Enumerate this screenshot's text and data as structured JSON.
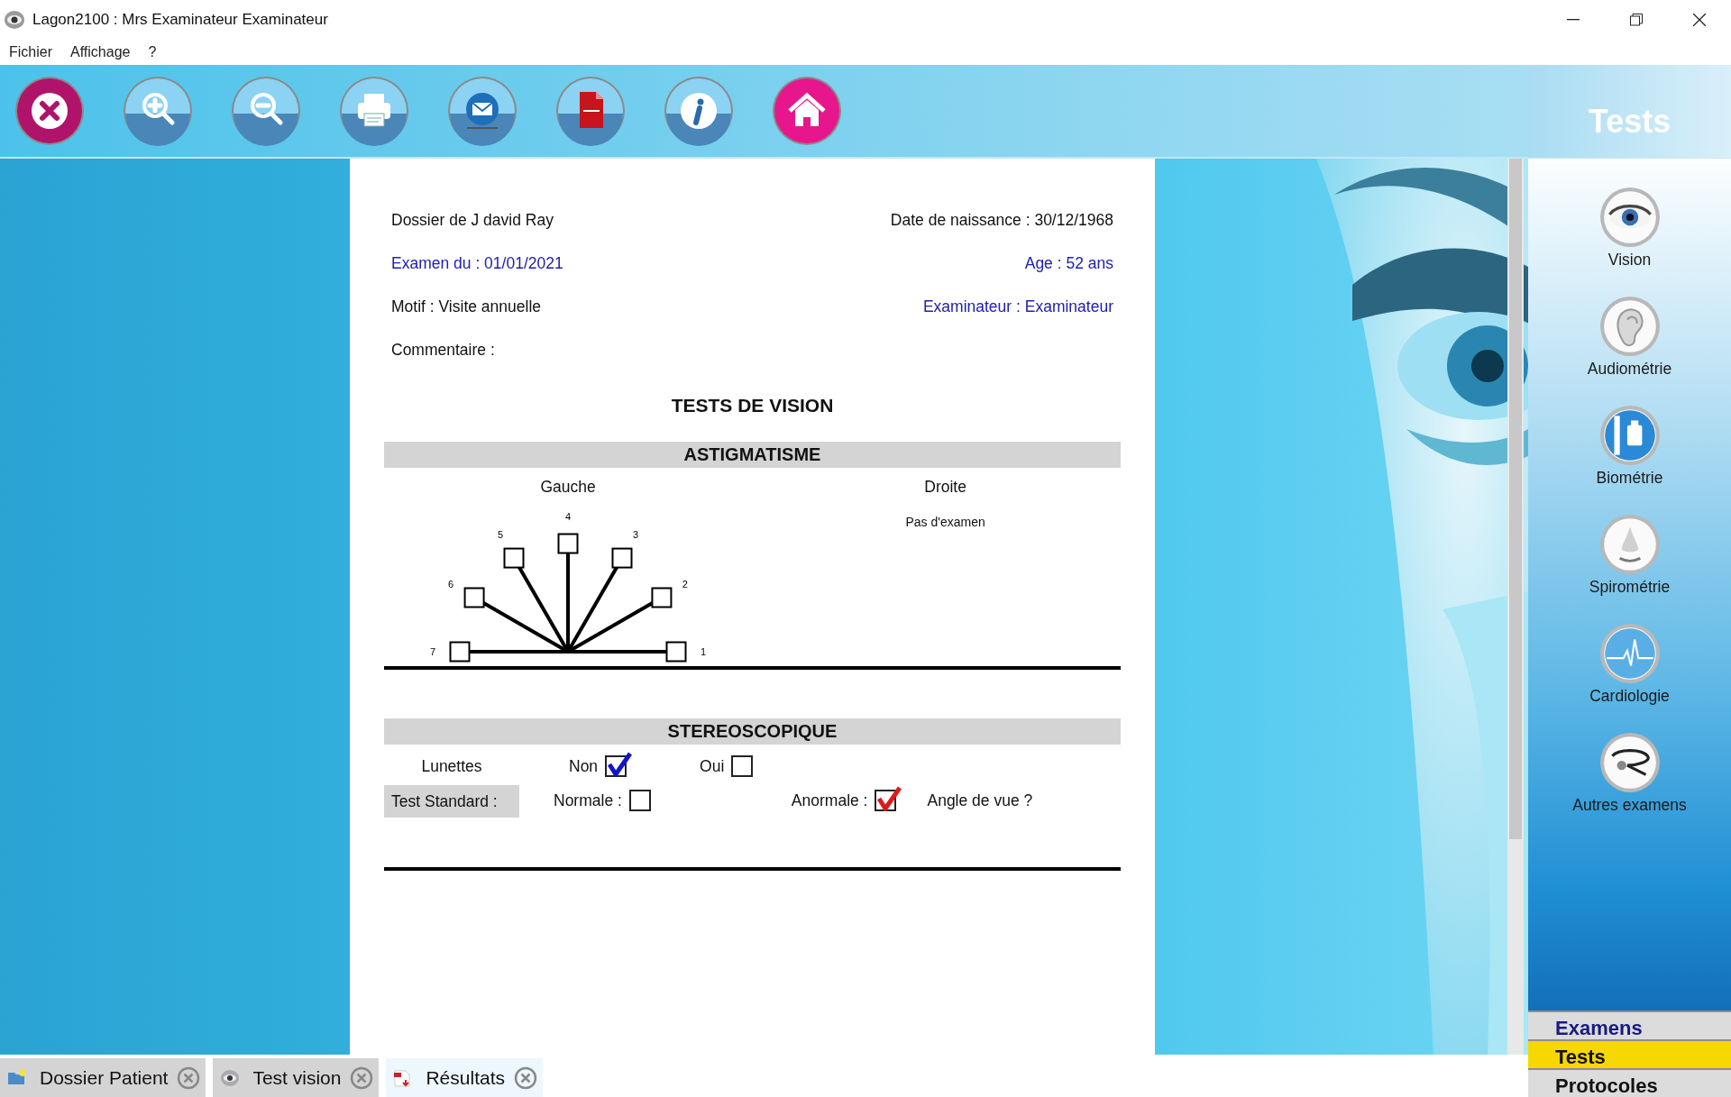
{
  "window": {
    "title": "Lagon2100  : Mrs Examinateur Examinateur"
  },
  "menu": [
    {
      "label": "Fichier"
    },
    {
      "label": "Affichage"
    },
    {
      "label": "?"
    }
  ],
  "toolbar": [
    {
      "kind": "close"
    },
    {
      "kind": "zoom-in"
    },
    {
      "kind": "zoom-out"
    },
    {
      "kind": "print"
    },
    {
      "kind": "mail"
    },
    {
      "kind": "pdf"
    },
    {
      "kind": "info"
    },
    {
      "kind": "home"
    }
  ],
  "document": {
    "header_rows": [
      {
        "left": {
          "text": "Dossier de J david Ray",
          "color": "#111111"
        },
        "right": {
          "text": "Date de naissance : 30/12/1968",
          "color": "#111111"
        }
      },
      {
        "left": {
          "text": "Examen du : 01/01/2021",
          "color": "#2020b0"
        },
        "right": {
          "text": "Age : 52 ans",
          "color": "#2020b0"
        }
      },
      {
        "left": {
          "text": "Motif : Visite annuelle",
          "color": "#111111"
        },
        "right": {
          "text": "Examinateur : Examinateur",
          "color": "#2020b0"
        }
      },
      {
        "left": {
          "text": "Commentaire :",
          "color": "#111111"
        }
      }
    ],
    "title": "TESTS DE VISION",
    "astigmatism": {
      "heading": "ASTIGMATISME",
      "left": {
        "label": "Gauche",
        "marks": [
          {
            "label": "1",
            "checked": false
          },
          {
            "label": "2",
            "checked": false
          },
          {
            "label": "3",
            "checked": false
          },
          {
            "label": "4",
            "checked": false
          },
          {
            "label": "5",
            "checked": false
          },
          {
            "label": "6",
            "checked": false
          },
          {
            "label": "7",
            "checked": false
          }
        ]
      },
      "right": {
        "label": "Droite",
        "note": "Pas d'examen"
      }
    },
    "stereoscopic": {
      "heading": "STEREOSCOPIQUE",
      "glasses": {
        "label": "Lunettes",
        "options": [
          {
            "label": "Non",
            "checked": true
          },
          {
            "label": "Oui",
            "checked": false
          }
        ]
      },
      "test": {
        "label": "Test Standard :",
        "options": [
          {
            "label": "Normale :",
            "checked": false
          },
          {
            "label": "Anormale :",
            "checked": true
          }
        ],
        "note": "Angle de vue ?"
      }
    }
  },
  "sidebar": {
    "title": "Tests",
    "items": [
      {
        "kind": "eye",
        "label": "Vision"
      },
      {
        "kind": "ear",
        "label": "Audiométrie"
      },
      {
        "kind": "ruler",
        "label": "Biométrie"
      },
      {
        "kind": "nose",
        "label": "Spirométrie"
      },
      {
        "kind": "ecg",
        "label": "Cardiologie"
      },
      {
        "kind": "stethoscope",
        "label": "Autres examens"
      }
    ],
    "sections": [
      {
        "label": "Examens",
        "selected": false,
        "hovered": true
      },
      {
        "label": "Tests",
        "selected": true,
        "hovered": false
      },
      {
        "label": "Protocoles",
        "selected": false,
        "hovered": false
      }
    ]
  },
  "tabs": [
    {
      "kind": "folder",
      "label": "Dossier Patient",
      "selected": false
    },
    {
      "kind": "eye",
      "label": "Test vision",
      "selected": false
    },
    {
      "kind": "pdf",
      "label": "Résultats",
      "selected": true
    }
  ]
}
